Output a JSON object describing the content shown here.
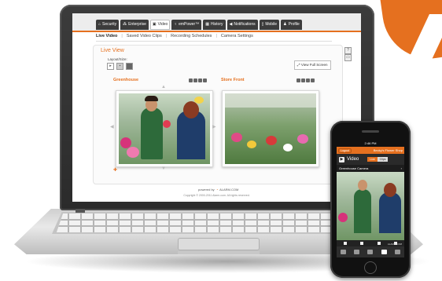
{
  "brand_color": "#e5701f",
  "laptop": {
    "nav_tabs": [
      {
        "label": "Security",
        "icon": "home-icon"
      },
      {
        "label": "Enterprise",
        "icon": "network-icon"
      },
      {
        "label": "Video",
        "icon": "video-icon",
        "active": true
      },
      {
        "label": "emPower™",
        "icon": "bulb-icon"
      },
      {
        "label": "History",
        "icon": "calendar-icon"
      },
      {
        "label": "Notifications",
        "icon": "megaphone-icon"
      },
      {
        "label": "Mobile",
        "icon": "phone-icon"
      },
      {
        "label": "Profile",
        "icon": "user-icon"
      }
    ],
    "subnav": [
      "Live Video",
      "Saved Video Clips",
      "Recording Schedules",
      "Camera Settings"
    ],
    "panel_title": "Live View",
    "layout_label": "Layout/Size:",
    "full_screen_label": "View Full Screen",
    "cameras": [
      {
        "name": "Greenhouse"
      },
      {
        "name": "Store Front"
      }
    ],
    "footer_powered": "powered by",
    "footer_brand": "ALARM.COM",
    "footer_copyright": "Copyright © 2000-2011 Alarm.com. All rights reserved."
  },
  "phone": {
    "time": "2:46 PM",
    "left_btn": "Logout",
    "title": "Becky's Flower Shop",
    "section": "Video",
    "segments": [
      "Live",
      "Clips"
    ],
    "camera_name": "Greenhouse Camera",
    "brand": "ALARM.COM"
  }
}
